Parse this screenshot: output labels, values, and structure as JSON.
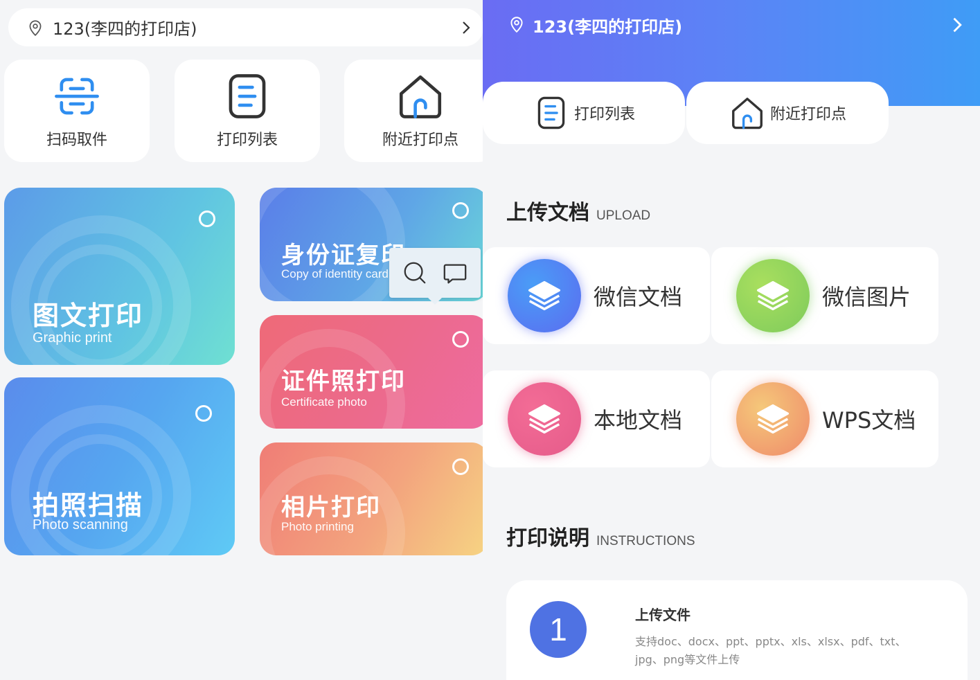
{
  "location": {
    "store_name": "123(李四的打印店)"
  },
  "left": {
    "quick_actions": [
      {
        "label": "扫码取件",
        "icon": "scan-icon"
      },
      {
        "label": "打印列表",
        "icon": "list-icon"
      },
      {
        "label": "附近打印点",
        "icon": "home-icon"
      }
    ],
    "cards": [
      {
        "title": "图文打印",
        "subtitle": "Graphic print"
      },
      {
        "title": "拍照扫描",
        "subtitle": "Photo scanning"
      },
      {
        "title": "身份证复印",
        "subtitle": "Copy of identity card"
      },
      {
        "title": "证件照打印",
        "subtitle": "Certificate photo"
      },
      {
        "title": "相片打印",
        "subtitle": "Photo printing"
      }
    ],
    "tooltip": {
      "icons": [
        "search-icon",
        "comment-icon"
      ]
    }
  },
  "right": {
    "quick_actions": [
      {
        "label": "打印列表",
        "icon": "list-icon"
      },
      {
        "label": "附近打印点",
        "icon": "home-icon"
      }
    ],
    "upload": {
      "title": "上传文档",
      "subtitle": "UPLOAD",
      "items": [
        {
          "label": "微信文档",
          "color": "#5b7cf5"
        },
        {
          "label": "微信图片",
          "color": "#8ed45d"
        },
        {
          "label": "本地文档",
          "color": "#ec5f8a"
        },
        {
          "label": "WPS文档",
          "color": "#f4a36a"
        }
      ]
    },
    "instructions": {
      "title": "打印说明",
      "subtitle": "INSTRUCTIONS",
      "steps": [
        {
          "number": "1",
          "title": "上传文件",
          "desc": "支持doc、docx、ppt、pptx、xls、xlsx、pdf、txt、jpg、png等文件上传"
        }
      ]
    }
  },
  "colors": {
    "accent_blue": "#3f8ef0",
    "hero_start": "#6a6cf3",
    "hero_end": "#3f9cf6"
  }
}
